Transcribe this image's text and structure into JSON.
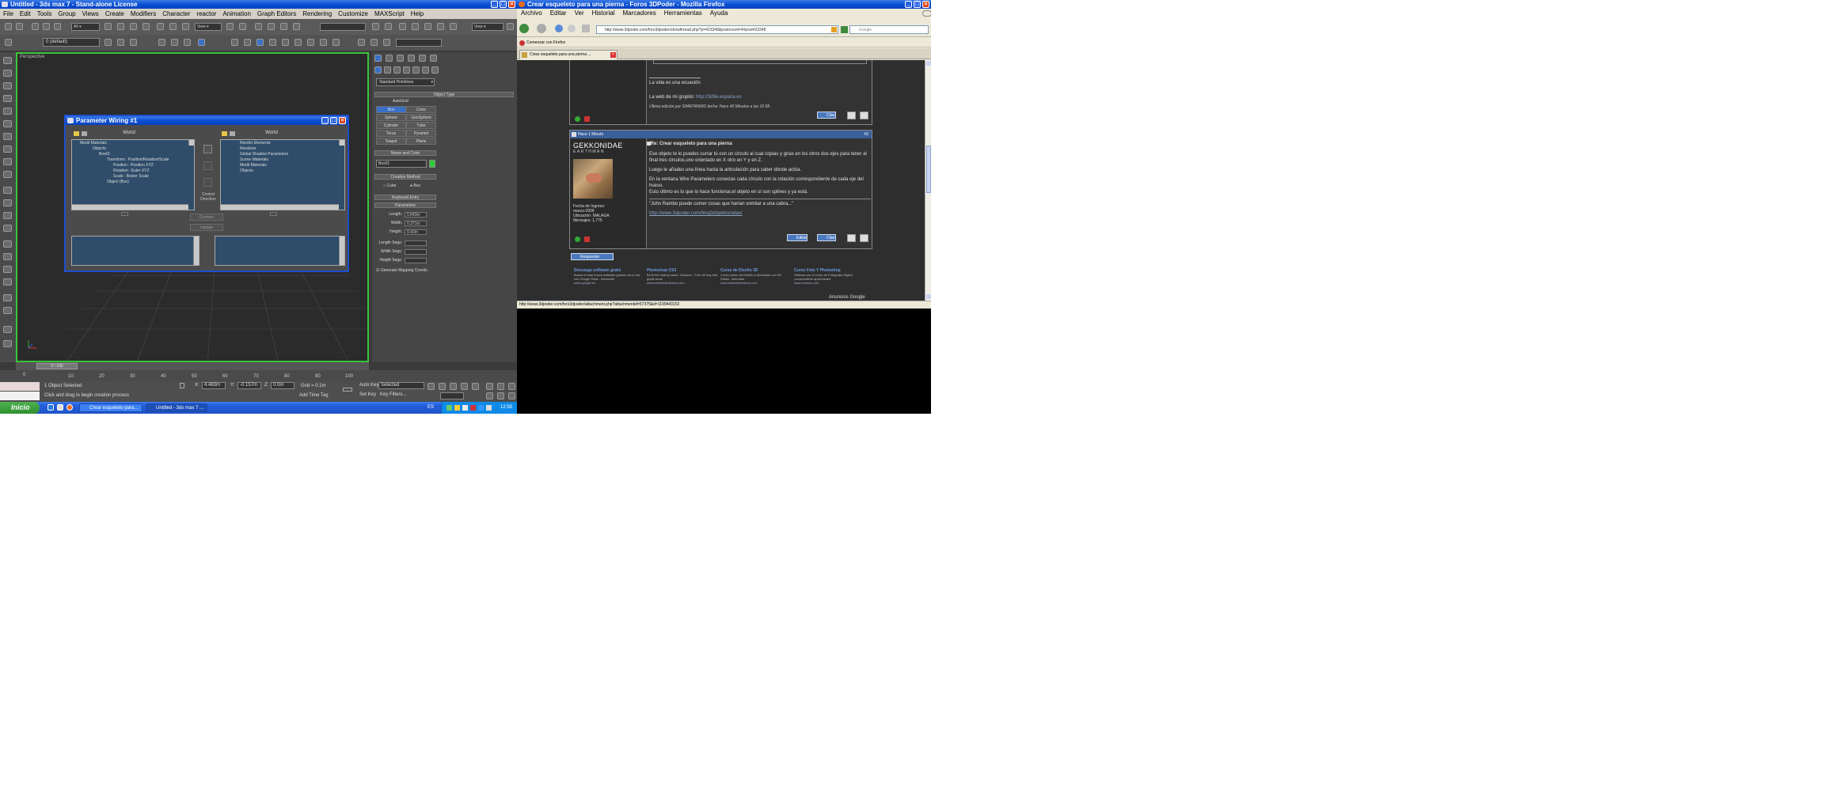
{
  "max": {
    "title": "Untitled - 3ds max 7 - Stand-alone License",
    "menu": [
      "File",
      "Edit",
      "Tools",
      "Group",
      "Views",
      "Create",
      "Modifiers",
      "Character",
      "reactor",
      "Animation",
      "Graph Editors",
      "Rendering",
      "Customize",
      "MAXScript",
      "Help"
    ],
    "selection_set": "0 (default)",
    "view_label": "View",
    "viewport_label": "Perspective",
    "cmd": {
      "category": "Standard Primitives",
      "object_type": "Object Type",
      "autogrid": "AutoGrid",
      "buttons": [
        [
          "Box",
          "Cone"
        ],
        [
          "Sphere",
          "GeoSphere"
        ],
        [
          "Cylinder",
          "Tube"
        ],
        [
          "Torus",
          "Pyramid"
        ],
        [
          "Teapot",
          "Plane"
        ]
      ],
      "name_color": "Name and Color",
      "object_name": "Box01",
      "creation_method": "Creation Method",
      "cube": "Cube",
      "box": "Box",
      "keyboard_entry": "Keyboard Entry",
      "parameters": "Parameters",
      "params": [
        [
          "Length:",
          "0.843m"
        ],
        [
          "Width:",
          "0.371m"
        ],
        [
          "Height:",
          "0.42m"
        ],
        [
          "Length Segs:",
          ""
        ],
        [
          "Width Segs:",
          ""
        ],
        [
          "Height Segs:",
          ""
        ]
      ],
      "gen_mapping": "Generate Mapping Coords."
    },
    "pw": {
      "title": "Parameter Wiring #1",
      "left_header": "World",
      "right_header": "World",
      "left_tree": [
        "Medit Materials",
        "Objects",
        "Box01",
        "Transform : Position/Rotation/Scale",
        "Position : Position XYZ",
        "Rotation : Euler XYZ",
        "Scale : Bezier Scale",
        "Object (Box)"
      ],
      "right_tree": [
        "Render Elements",
        "Renderer",
        "Global Shadow Parameters",
        "Scene Materials",
        "Medit Materials",
        "Objects"
      ],
      "control_direction": "Control Direction",
      "connect": "Connect",
      "update": "Update"
    },
    "ruler_ticks": [
      "0",
      "10",
      "20",
      "30",
      "40",
      "50",
      "60",
      "70",
      "80",
      "90",
      "100"
    ],
    "frame": "0 / 100",
    "status_selected": "1 Object Selected",
    "status_prompt": "Click and drag to begin creation process",
    "coords": {
      "x_label": "X:",
      "x": "4.483m",
      "y_label": "Y:",
      "y": "-0.157m",
      "z_label": "Z:",
      "z": "0.0m"
    },
    "grid": "Grid = 0.1m",
    "autokey": "Auto Key",
    "setkey": "Set Key",
    "selected": "Selected",
    "keyfilters": "Key Filters...",
    "addtimetag": "Add Time Tag"
  },
  "taskbar": {
    "start": "Inicio",
    "tasks": [
      "Crear esqueleto para...",
      "Untitled - 3ds max 7 ..."
    ],
    "lang": "ES",
    "clock": "12:58"
  },
  "ff": {
    "title": "Crear esqueleto para una pierna - Foros 3DPoder - Mozilla Firefox",
    "menu": [
      "Archivo",
      "Editar",
      "Ver",
      "Historial",
      "Marcadores",
      "Herramientas",
      "Ayuda"
    ],
    "url": "http://www.3dpoder.com/foro3dpoder/showthread.php?p=423348&postcount=4#post423348",
    "search_placeholder": "Google",
    "bookmark": "Comenzar con Firefox",
    "tab": "Crear esqueleto para una pierna ...",
    "status_url": "http://www.3dpoder.com/foro3dpoder/attachment.php?attachmentid=57375&d=1190443152",
    "post1": {
      "quote": "La vida es una ecuación",
      "web": "La web de mi grupito:",
      "web_link": "http://3d9e.espana.es",
      "edited": "Última edición por SPARTANWS fecha: Hace 40 Minutos a las 10:58 .",
      "quote_btn": "Citar"
    },
    "post2": {
      "header": "Hace 1 Minuto",
      "number": "#2",
      "user": "GEKKONIDAE",
      "rank": "EARTHMAN",
      "info": [
        "Fecha de Ingreso:",
        "marzo-2006",
        "Ubicación: MALAGA",
        "Mensajes: 1,775"
      ],
      "subject": "Re: Crear esqueleto para una pierna",
      "body": [
        "Ese objeto te lo puedes currar tú con un circulo al cual copias y giras en los otros dos ejes para tener al final tres circulos,uno orientado en X otro en Y y en Z.",
        "Luego le añades una línea hasta la articulación para saber dónde actúa.",
        "En la ventana Wire Parameters conectas cada círculo con la rotación correspondiente de cada eje del hueso.",
        "Esto último es lo que lo hace funcionar,el objeto en sí son splines y ya está.",
        "\"John Rambo puede comer cosas que harían vomitar a una cabra...\""
      ],
      "link": "http://www.3dpoder.com/blog3d/gekkonidae/",
      "edit_btn": "Editar",
      "quote_btn": "Citar"
    },
    "reply_btn": "Responder",
    "ads": [
      {
        "title": "Descarga software gratis",
        "text": "Busca el más nuevo software gratuito de la red con Google Pack - Informate",
        "url": "pack.google.es"
      },
      {
        "title": "Photoshop CS3",
        "text": "$139 full retail product. Genuine - Free 60 day trial guide book",
        "url": "www.revivardsoftware.com"
      },
      {
        "title": "Curso de Diseño 3D",
        "text": "Curso online de Diseño y Modelado con 3D Studio. Informate",
        "url": "www.educaformacion.com"
      },
      {
        "title": "Curso Foto Y Photoshop",
        "text": "Disfruta con el curso de Fotografía Digital ¡sorprenderte aprenderás!",
        "url": "www.cenoac.com"
      }
    ],
    "google_label": "Anuncios Google"
  },
  "colors": {
    "xp_blue": "#0a4fd3",
    "viewport_border": "#3ac43a",
    "dark_bg": "#2e2e2e"
  }
}
